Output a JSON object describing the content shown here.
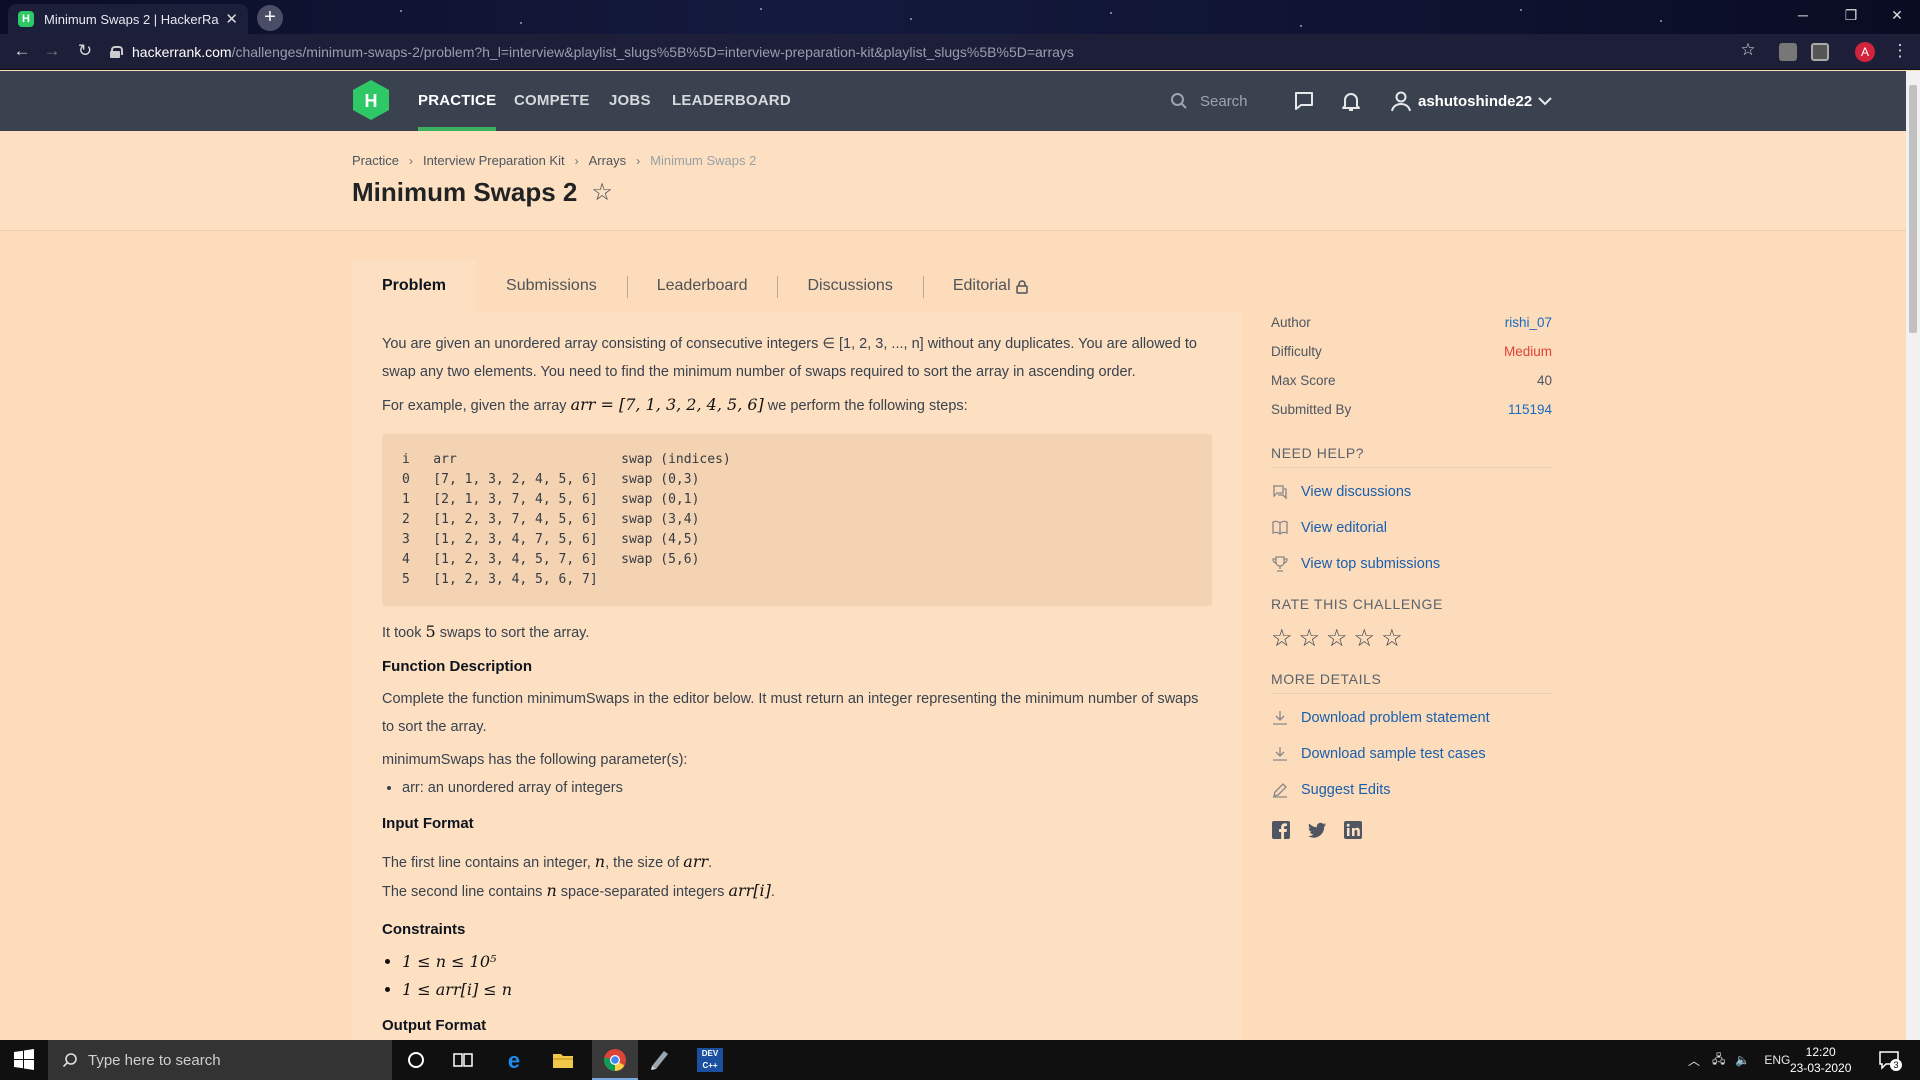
{
  "browser": {
    "tab_title": "Minimum Swaps 2 | HackerRank",
    "tab_favicon": "H",
    "url_host": "hackerrank.com",
    "url_path": "/challenges/minimum-swaps-2/problem?h_l=interview&playlist_slugs%5B%5D=interview-preparation-kit&playlist_slugs%5B%5D=arrays",
    "profile_initial": "A"
  },
  "nav": {
    "logo": "H",
    "links": [
      "PRACTICE",
      "COMPETE",
      "JOBS",
      "LEADERBOARD"
    ],
    "search_placeholder": "Search",
    "username": "ashutoshinde22"
  },
  "breadcrumb": [
    "Practice",
    "Interview Preparation Kit",
    "Arrays",
    "Minimum Swaps 2"
  ],
  "page_title": "Minimum Swaps 2",
  "tabs": [
    "Problem",
    "Submissions",
    "Leaderboard",
    "Discussions",
    "Editorial"
  ],
  "problem": {
    "intro": "You are given an unordered array consisting of consecutive integers ∈ [1, 2, 3, ..., n] without any duplicates. You are allowed to swap any two elements. You need to find the minimum number of swaps required to sort the array in ascending order.",
    "example_pre": "For example, given the array ",
    "example_math": "arr = [7, 1, 3, 2, 4, 5, 6]",
    "example_post": " we perform the following steps:",
    "code": "i   arr                     swap (indices)\n0   [7, 1, 3, 2, 4, 5, 6]   swap (0,3)\n1   [2, 1, 3, 7, 4, 5, 6]   swap (0,1)\n2   [1, 2, 3, 7, 4, 5, 6]   swap (3,4)\n3   [1, 2, 3, 4, 7, 5, 6]   swap (4,5)\n4   [1, 2, 3, 4, 5, 7, 6]   swap (5,6)\n5   [1, 2, 3, 4, 5, 6, 7]",
    "took_pre": "It took ",
    "took_num": "5",
    "took_post": " swaps to sort the array.",
    "fd_heading": "Function Description",
    "fd_text": "Complete the function minimumSwaps in the editor below. It must return an integer representing the minimum number of swaps to sort the array.",
    "params_intro": "minimumSwaps has the following parameter(s):",
    "param1": "arr: an unordered array of integers",
    "input_heading": "Input Format",
    "input_line1_pre": "The first line contains an integer, ",
    "input_line1_var": "n",
    "input_line1_mid": ", the size of ",
    "input_line1_var2": "arr",
    "input_line1_post": ".",
    "input_line2_pre": "The second line contains ",
    "input_line2_var": "n",
    "input_line2_mid": " space-separated integers ",
    "input_line2_var2": "arr[i]",
    "input_line2_post": ".",
    "constraints_heading": "Constraints",
    "constraint1": "1 ≤ n ≤ 10⁵",
    "constraint2": "1 ≤ arr[i] ≤ n",
    "output_heading": "Output Format"
  },
  "sidebar": {
    "author_label": "Author",
    "author_value": "rishi_07",
    "difficulty_label": "Difficulty",
    "difficulty_value": "Medium",
    "maxscore_label": "Max Score",
    "maxscore_value": "40",
    "submitted_label": "Submitted By",
    "submitted_value": "115194",
    "need_help": "NEED HELP?",
    "help_links": [
      "View discussions",
      "View editorial",
      "View top submissions"
    ],
    "rate_heading": "RATE THIS CHALLENGE",
    "more_heading": "MORE DETAILS",
    "more_links": [
      "Download problem statement",
      "Download sample test cases",
      "Suggest Edits"
    ]
  },
  "taskbar": {
    "search_placeholder": "Type here to search",
    "lang": "ENG",
    "time": "12:20",
    "date": "23-03-2020",
    "notification_count": "3"
  },
  "colors": {
    "accent_green": "#39b15e",
    "link_blue": "#1a6abf",
    "difficulty_red": "#e1413b",
    "nav_bg": "#39424e",
    "page_bg": "#fcdcbb"
  }
}
